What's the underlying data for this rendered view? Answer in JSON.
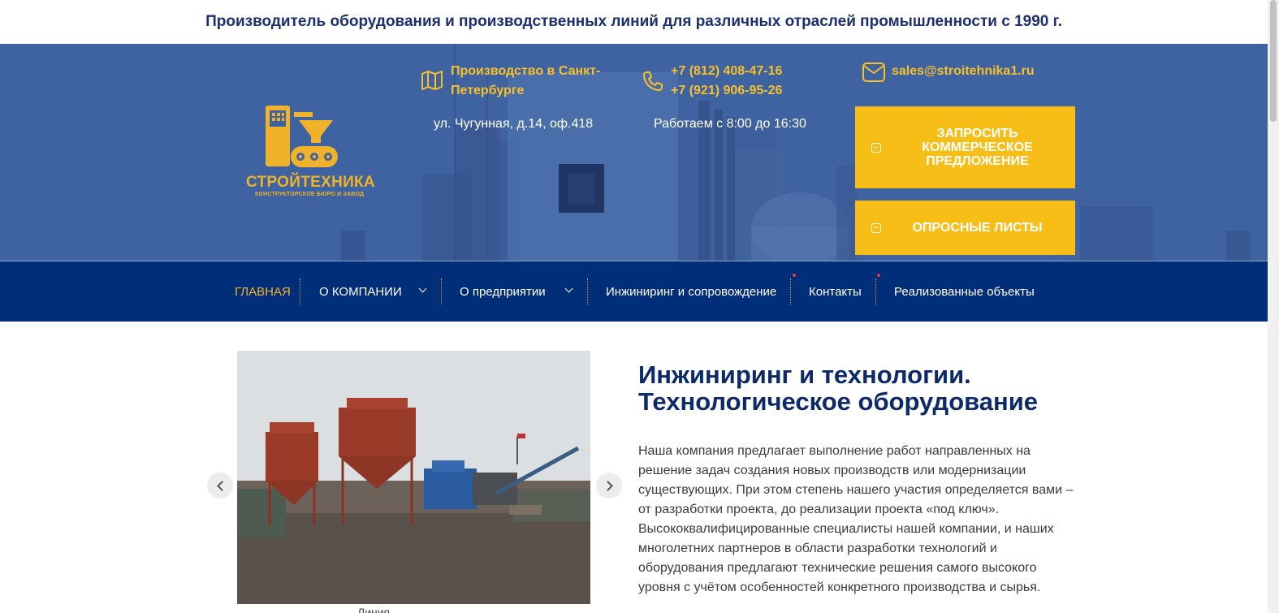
{
  "tagline": "Производитель оборудования и производственных линий для различных отраслей промышленности с 1990 г.",
  "logo": {
    "name": "СТРОЙТЕХНИКА",
    "subtitle": "КОНСТРУКТОРСКОЕ БЮРО И ЗАВОД",
    "icon": "factory-conveyor-icon"
  },
  "contacts": {
    "location": {
      "icon": "map-icon",
      "title_line1": "Производство в Санкт-",
      "title_line2": "Петербурге",
      "note": "ул. Чугунная, д.14, оф.418"
    },
    "phone": {
      "icon": "phone-icon",
      "phone1": "+7 (812) 408-47-16",
      "phone2": "+7 (921) 906-95-26",
      "note": "Работаем с 8:00 до 16:30"
    },
    "email": {
      "icon": "envelope-icon",
      "address": "sales@stroitehnika1.ru"
    }
  },
  "cta": {
    "request_line1": "ЗАПРОСИТЬ",
    "request_line2": "КОММЕРЧЕСКОЕ",
    "request_line3": "ПРЕДЛОЖЕНИЕ",
    "questionnaire": "ОПРОСНЫЕ ЛИСТЫ"
  },
  "nav": {
    "items": [
      {
        "label": "ГЛАВНАЯ",
        "active": true
      },
      {
        "label": "О КОМПАНИИ",
        "dropdown": true
      },
      {
        "label": "О предприятии",
        "dropdown": true
      },
      {
        "label": "Инжиниринг и сопровождение"
      },
      {
        "label": "Контакты"
      },
      {
        "label": "Реализованные объекты"
      }
    ]
  },
  "main": {
    "title_line1": "Инжиниринг и технологии.",
    "title_line2": "Технологическое оборудование",
    "body": "Наша компания предлагает выполнение работ направленных на решение задач создания новых производств или модернизации существующих. При этом степень нашего участия определяется вами – от разработки проекта, до реализации проекта «под ключ». Высококвалифицированные специалисты нашей компании, и наших многолетних партнеров в области разработки технологий и оборудования предлагают технические решения самого высокого уровня с учётом особенностей конкретного производства и сырья.",
    "caption": "Линия обогащения"
  },
  "colors": {
    "brand_yellow": "#f8be18",
    "nav_blue": "#002e78",
    "title_blue": "#0c2a6a",
    "header_blue": "#3b5e9c"
  }
}
